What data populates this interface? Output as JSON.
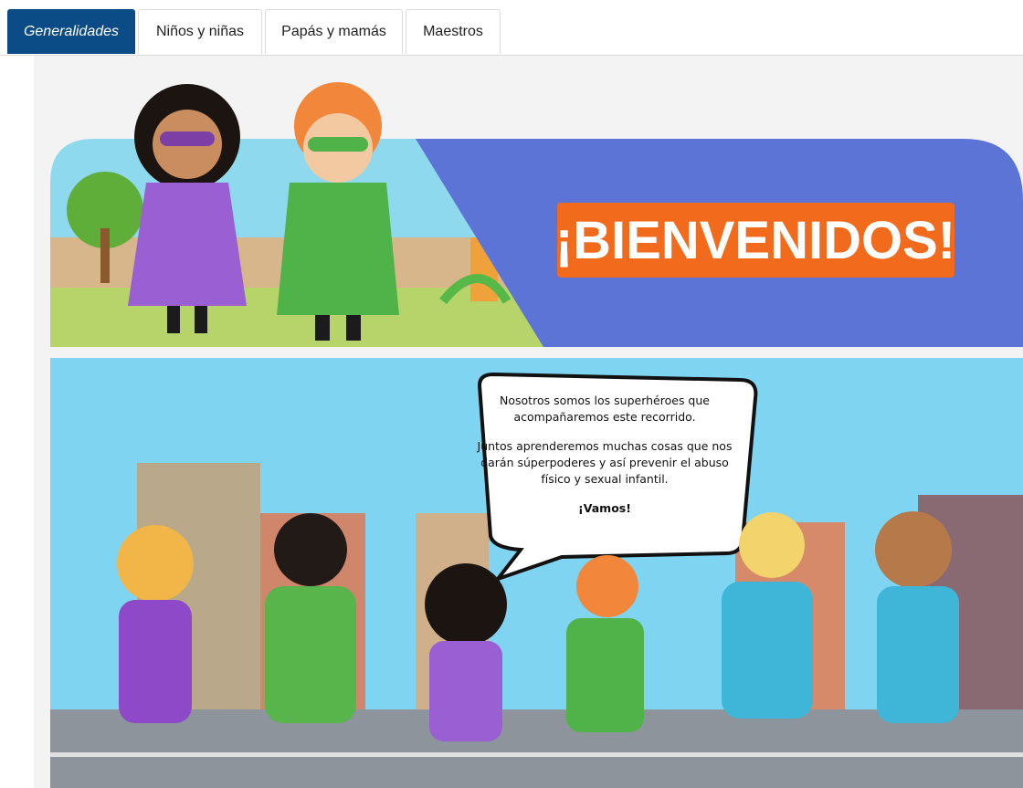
{
  "tabs": [
    {
      "label": "Generalidades",
      "active": true
    },
    {
      "label": "Niños y niñas",
      "active": false
    },
    {
      "label": "Papás y mamás",
      "active": false
    },
    {
      "label": "Maestros",
      "active": false
    }
  ],
  "banner": {
    "title": "¡BIENVENIDOS!",
    "colors": {
      "accent": "#f26a1b",
      "sky": "#5b74d6",
      "active_tab": "#0b4c86"
    }
  },
  "speech_bubble": {
    "line1": "Nosotros somos los superhéroes que acompañaremos este recorrido.",
    "line2": "Juntos aprenderemos muchas cosas que nos darán súperpoderes y así prevenir el abuso físico y sexual infantil.",
    "line3": "¡Vamos!"
  }
}
